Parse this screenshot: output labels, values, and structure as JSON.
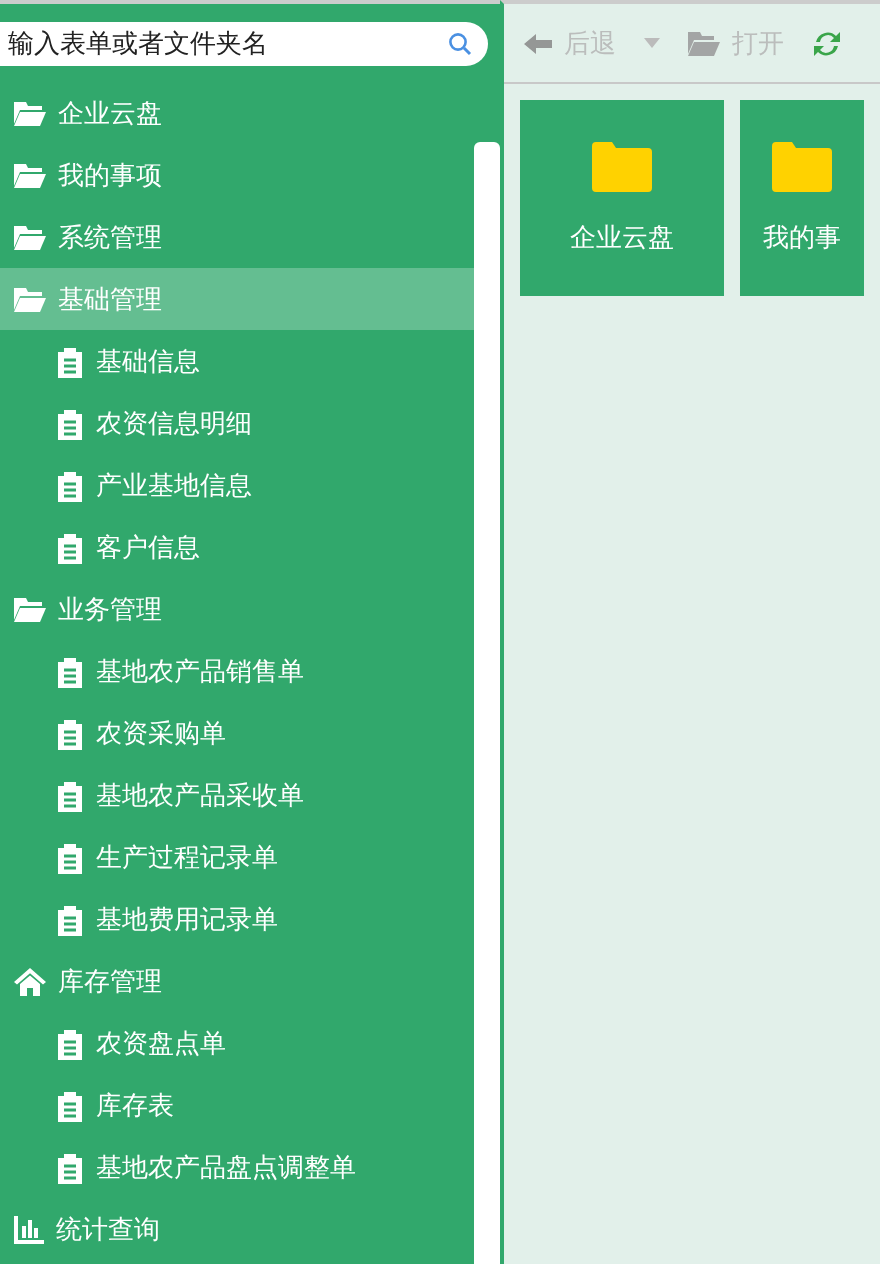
{
  "search": {
    "placeholder": "输入表单或者文件夹名"
  },
  "sidebar": {
    "items": [
      {
        "label": "企业云盘",
        "kind": "folder",
        "selected": false
      },
      {
        "label": "我的事项",
        "kind": "folder",
        "selected": false
      },
      {
        "label": "系统管理",
        "kind": "folder",
        "selected": false
      },
      {
        "label": "基础管理",
        "kind": "folder",
        "selected": true,
        "children": [
          {
            "label": "基础信息",
            "selected": false
          },
          {
            "label": "农资信息明细",
            "selected": false
          },
          {
            "label": "产业基地信息",
            "selected": false
          },
          {
            "label": "客户信息",
            "selected": false
          }
        ]
      },
      {
        "label": "业务管理",
        "kind": "folder",
        "selected": false,
        "children": [
          {
            "label": "基地农产品销售单",
            "selected": false
          },
          {
            "label": "农资采购单",
            "selected": false
          },
          {
            "label": "基地农产品采收单",
            "selected": false
          },
          {
            "label": "生产过程记录单",
            "selected": false
          },
          {
            "label": "基地费用记录单",
            "selected": false
          }
        ]
      },
      {
        "label": "库存管理",
        "kind": "home",
        "selected": false,
        "children": [
          {
            "label": "农资盘点单",
            "selected": false
          },
          {
            "label": "库存表",
            "selected": false
          },
          {
            "label": "基地农产品盘点调整单",
            "selected": false
          }
        ]
      },
      {
        "label": "统计查询",
        "kind": "chart",
        "selected": false
      }
    ]
  },
  "toolbar": {
    "buttons": [
      {
        "kind": "back",
        "label": "后退",
        "disabled": true
      },
      {
        "kind": "open",
        "label": "打开",
        "disabled": true
      },
      {
        "kind": "refresh",
        "disabled": false
      }
    ]
  },
  "tiles": [
    {
      "label": "企业云盘"
    },
    {
      "label": "我的事"
    }
  ]
}
